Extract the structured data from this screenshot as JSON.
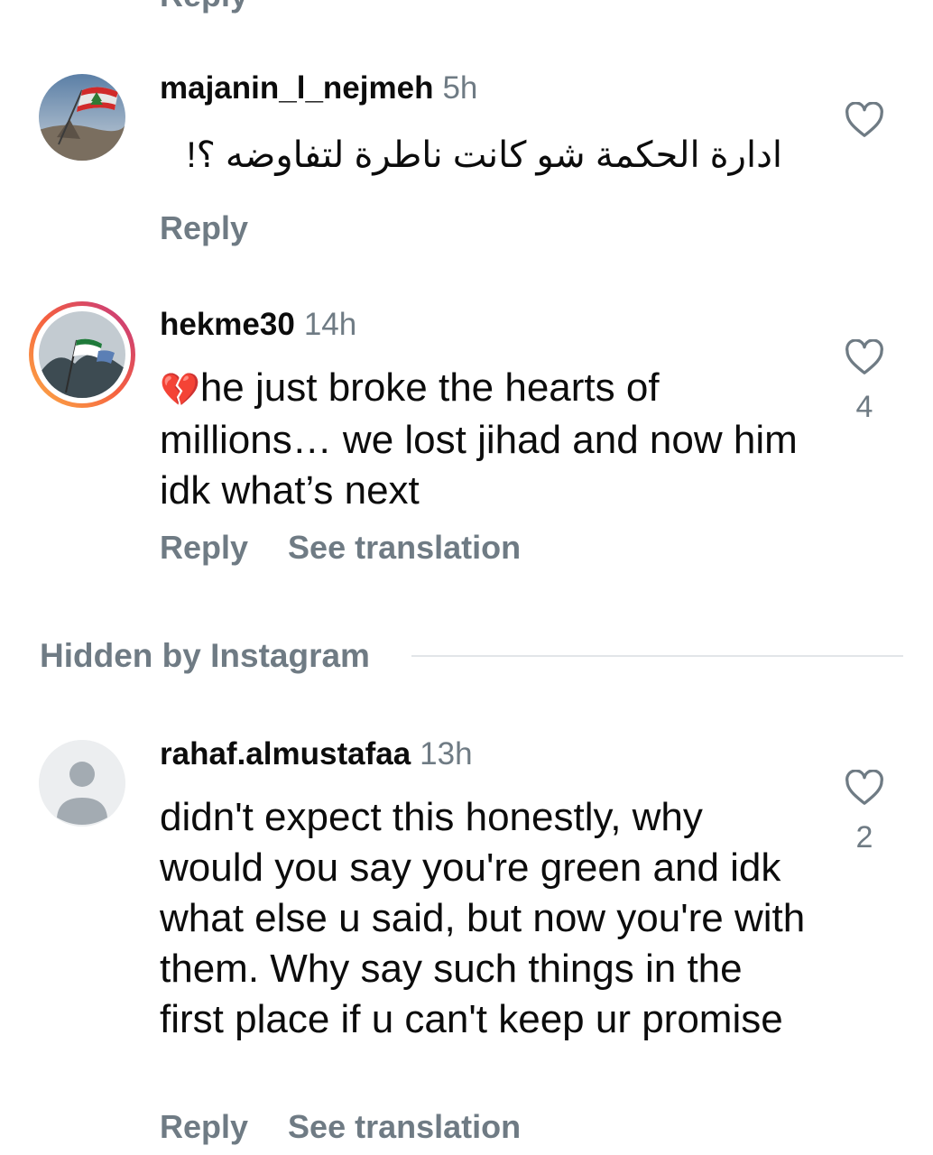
{
  "top_partial": {
    "reply_label": "Reply"
  },
  "comments": [
    {
      "username": "majanin_l_nejmeh",
      "time": "5h",
      "text": "ادارة الحكمة شو كانت ناطرة لتفاوضه ؟!",
      "reply_label": "Reply",
      "like_count": ""
    },
    {
      "username": "hekme30",
      "time": "14h",
      "emoji": "💔",
      "text": "he just broke the hearts of millions… we lost jihad and now him idk what’s next",
      "reply_label": "Reply",
      "see_translation_label": "See translation",
      "like_count": "4"
    }
  ],
  "hidden_section": {
    "label": "Hidden by Instagram",
    "comment": {
      "username": "rahaf.almustafaa",
      "time": "13h",
      "text": "didn't expect this honestly, why would you say you're green and idk what else u said, but now you're with them. Why say such things in the first place if u can't keep ur promise",
      "reply_label": "Reply",
      "see_translation_label": "See translation",
      "like_count": "2"
    }
  },
  "colors": {
    "text": "#0c0c0c",
    "secondary": "#6f7b84",
    "divider": "#e2e5e8",
    "story_ring_start": "#fcaf45",
    "story_ring_end": "#c13584"
  },
  "icons": {
    "like": "heart-outline-icon",
    "default_avatar": "default-avatar-icon",
    "emoji": "broken-heart-emoji"
  }
}
